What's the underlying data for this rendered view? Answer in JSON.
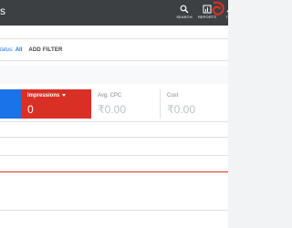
{
  "appbar": {
    "title": "s",
    "tools": [
      {
        "icon": "search-icon",
        "label": "SEARCH"
      },
      {
        "icon": "reports-icon",
        "label": "REPORTS"
      },
      {
        "icon": "tools-icon",
        "label": "TO..."
      }
    ]
  },
  "filters": {
    "status_label": "tatus:",
    "status_value": "All",
    "add_filter": "ADD FILTER"
  },
  "metrics": [
    {
      "label": "Impressions",
      "value": "0",
      "color": "#d93025",
      "selected": true
    },
    {
      "label": "Avg. CPC",
      "value": "₹0.00"
    },
    {
      "label": "Cost",
      "value": "₹0.00"
    }
  ],
  "colors": {
    "appbar": "#3c4043",
    "selected_metric": "#d93025",
    "blue_metric": "#1a73e8",
    "annotation": "#d93025"
  }
}
